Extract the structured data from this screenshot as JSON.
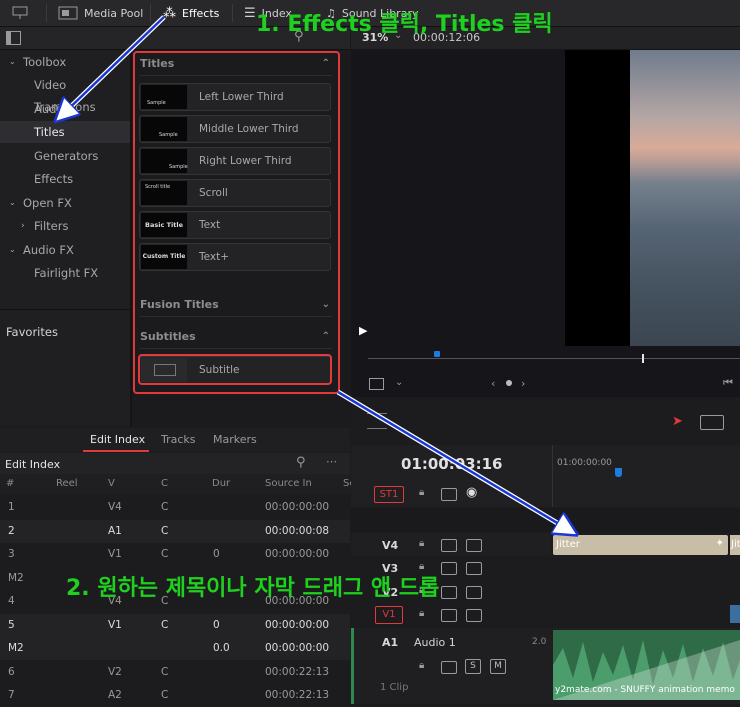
{
  "toolbar": {
    "media_pool": "Media Pool",
    "effects": "Effects",
    "index": "Index",
    "sound_library": "Sound Library"
  },
  "viewer": {
    "zoom": "31%",
    "timecode": "00:00:12:06"
  },
  "tree": {
    "toolbox": "Toolbox",
    "video_transitions": "Video Transitions",
    "audio_transitions": "Audio Transitions",
    "titles": "Titles",
    "generators": "Generators",
    "effects": "Effects",
    "open_fx": "Open FX",
    "filters": "Filters",
    "audio_fx": "Audio FX",
    "fairlight_fx": "Fairlight FX",
    "favorites": "Favorites"
  },
  "titles_section": {
    "header": "Titles",
    "items": [
      {
        "label": "Left Lower Third",
        "thumb": "Sample"
      },
      {
        "label": "Middle Lower Third",
        "thumb": "Sample"
      },
      {
        "label": "Right Lower Third",
        "thumb": "Sample"
      },
      {
        "label": "Scroll",
        "thumb": "Scroll title"
      },
      {
        "label": "Text",
        "thumb": "Basic Title"
      },
      {
        "label": "Text+",
        "thumb": "Custom Title"
      }
    ]
  },
  "fusion_titles": {
    "header": "Fusion Titles"
  },
  "subtitles_section": {
    "header": "Subtitles",
    "item": "Subtitle"
  },
  "edit_index": {
    "tabs": [
      "Edit Index",
      "Tracks",
      "Markers"
    ],
    "title": "Edit Index",
    "columns": [
      "#",
      "Reel",
      "V",
      "C",
      "Dur",
      "Source In",
      "Se"
    ],
    "rows": [
      {
        "n": "1",
        "v": "V4",
        "c": "C",
        "dur": "",
        "src": "00:00:00:00",
        "b": false
      },
      {
        "n": "2",
        "v": "A1",
        "c": "C",
        "dur": "",
        "src": "00:00:00:08",
        "b": true
      },
      {
        "n": "3",
        "v": "V1",
        "c": "C",
        "dur": "0",
        "src": "00:00:00:00",
        "b": false
      },
      {
        "n": "M2",
        "v": "",
        "c": "",
        "dur": "",
        "src": "",
        "b": false
      },
      {
        "n": "4",
        "v": "V4",
        "c": "C",
        "dur": "",
        "src": "00:00:00:00",
        "b": false
      },
      {
        "n": "5",
        "v": "V1",
        "c": "C",
        "dur": "0",
        "src": "00:00:00:00",
        "b": true
      },
      {
        "n": "M2",
        "v": "",
        "c": "",
        "dur": "0.0",
        "src": "00:00:00:00",
        "b": true
      },
      {
        "n": "6",
        "v": "V2",
        "c": "C",
        "dur": "",
        "src": "00:00:22:13",
        "b": false
      },
      {
        "n": "7",
        "v": "A2",
        "c": "C",
        "dur": "",
        "src": "00:00:22:13",
        "b": false
      }
    ]
  },
  "timeline": {
    "timecode": "01:00:03:16",
    "ruler": "01:00:00:00",
    "tracks": {
      "st1": "ST1",
      "v4": "V4",
      "v3": "V3",
      "v2": "V2",
      "v1": "V1",
      "a1": "A1"
    },
    "audio_name": "Audio 1",
    "audio_level": "2.0",
    "clip_count": "1 Clip",
    "jitter": "Jitter",
    "jitter2": "Jit",
    "audio_clip": "y2mate.com - SNUFFY   animation memo",
    "solo": "S",
    "mute": "M"
  },
  "annotations": {
    "step1": "1. Effects 클릭, Titles 클릭",
    "step2": "2. 원하는 제목이나 자막 드래그 앤 드롭"
  },
  "colors": {
    "accent_red": "#e03a3a",
    "annotation_green": "#1fd11f",
    "arrow_blue": "#1a37d6"
  }
}
